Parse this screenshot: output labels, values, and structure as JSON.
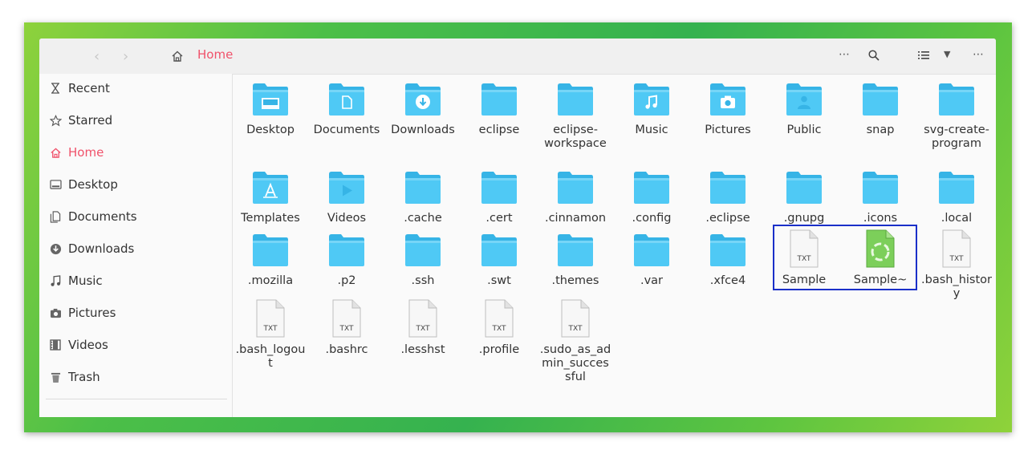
{
  "header": {
    "location": "Home"
  },
  "sidebar": {
    "items": [
      {
        "label": "Recent",
        "icon": "clock-icon"
      },
      {
        "label": "Starred",
        "icon": "star-icon"
      },
      {
        "label": "Home",
        "icon": "home-icon",
        "active": true
      },
      {
        "label": "Desktop",
        "icon": "desktop-icon"
      },
      {
        "label": "Documents",
        "icon": "document-icon"
      },
      {
        "label": "Downloads",
        "icon": "download-icon"
      },
      {
        "label": "Music",
        "icon": "music-icon"
      },
      {
        "label": "Pictures",
        "icon": "camera-icon"
      },
      {
        "label": "Videos",
        "icon": "film-icon"
      },
      {
        "label": "Trash",
        "icon": "trash-icon"
      }
    ]
  },
  "files": [
    {
      "label": "Desktop",
      "type": "folder",
      "glyph": "desktop"
    },
    {
      "label": "Documents",
      "type": "folder",
      "glyph": "document"
    },
    {
      "label": "Downloads",
      "type": "folder",
      "glyph": "download"
    },
    {
      "label": "eclipse",
      "type": "folder"
    },
    {
      "label": "eclipse-workspace",
      "type": "folder"
    },
    {
      "label": "Music",
      "type": "folder",
      "glyph": "music"
    },
    {
      "label": "Pictures",
      "type": "folder",
      "glyph": "camera"
    },
    {
      "label": "Public",
      "type": "folder",
      "glyph": "person"
    },
    {
      "label": "snap",
      "type": "folder"
    },
    {
      "label": "svg-create-program",
      "type": "folder"
    },
    {
      "label": "Templates",
      "type": "folder",
      "glyph": "template"
    },
    {
      "label": "Videos",
      "type": "folder",
      "glyph": "play"
    },
    {
      "label": ".cache",
      "type": "folder"
    },
    {
      "label": ".cert",
      "type": "folder"
    },
    {
      "label": ".cinnamon",
      "type": "folder"
    },
    {
      "label": ".config",
      "type": "folder"
    },
    {
      "label": ".eclipse",
      "type": "folder"
    },
    {
      "label": ".gnupg",
      "type": "folder"
    },
    {
      "label": ".icons",
      "type": "folder"
    },
    {
      "label": ".local",
      "type": "folder"
    },
    {
      "label": ".mozilla",
      "type": "folder"
    },
    {
      "label": ".p2",
      "type": "folder"
    },
    {
      "label": ".ssh",
      "type": "folder"
    },
    {
      "label": ".swt",
      "type": "folder"
    },
    {
      "label": ".themes",
      "type": "folder"
    },
    {
      "label": ".var",
      "type": "folder"
    },
    {
      "label": ".xfce4",
      "type": "folder"
    },
    {
      "label": "Sample",
      "type": "txt",
      "selected": true
    },
    {
      "label": "Sample~",
      "type": "backup",
      "selected": true
    },
    {
      "label": ".bash_history",
      "type": "txt"
    },
    {
      "label": ".bash_logout",
      "type": "txt"
    },
    {
      "label": ".bashrc",
      "type": "txt"
    },
    {
      "label": ".lesshst",
      "type": "txt"
    },
    {
      "label": ".profile",
      "type": "txt"
    },
    {
      "label": ".sudo_as_admin_successful",
      "type": "txt"
    }
  ],
  "file_badge_text": "TXT",
  "colors": {
    "accent": "#f0516a",
    "folder": "#4fc9f5",
    "folder_dark": "#36b4e6",
    "selection_border": "#1a2fc9",
    "background_green": "#4cbf48"
  }
}
